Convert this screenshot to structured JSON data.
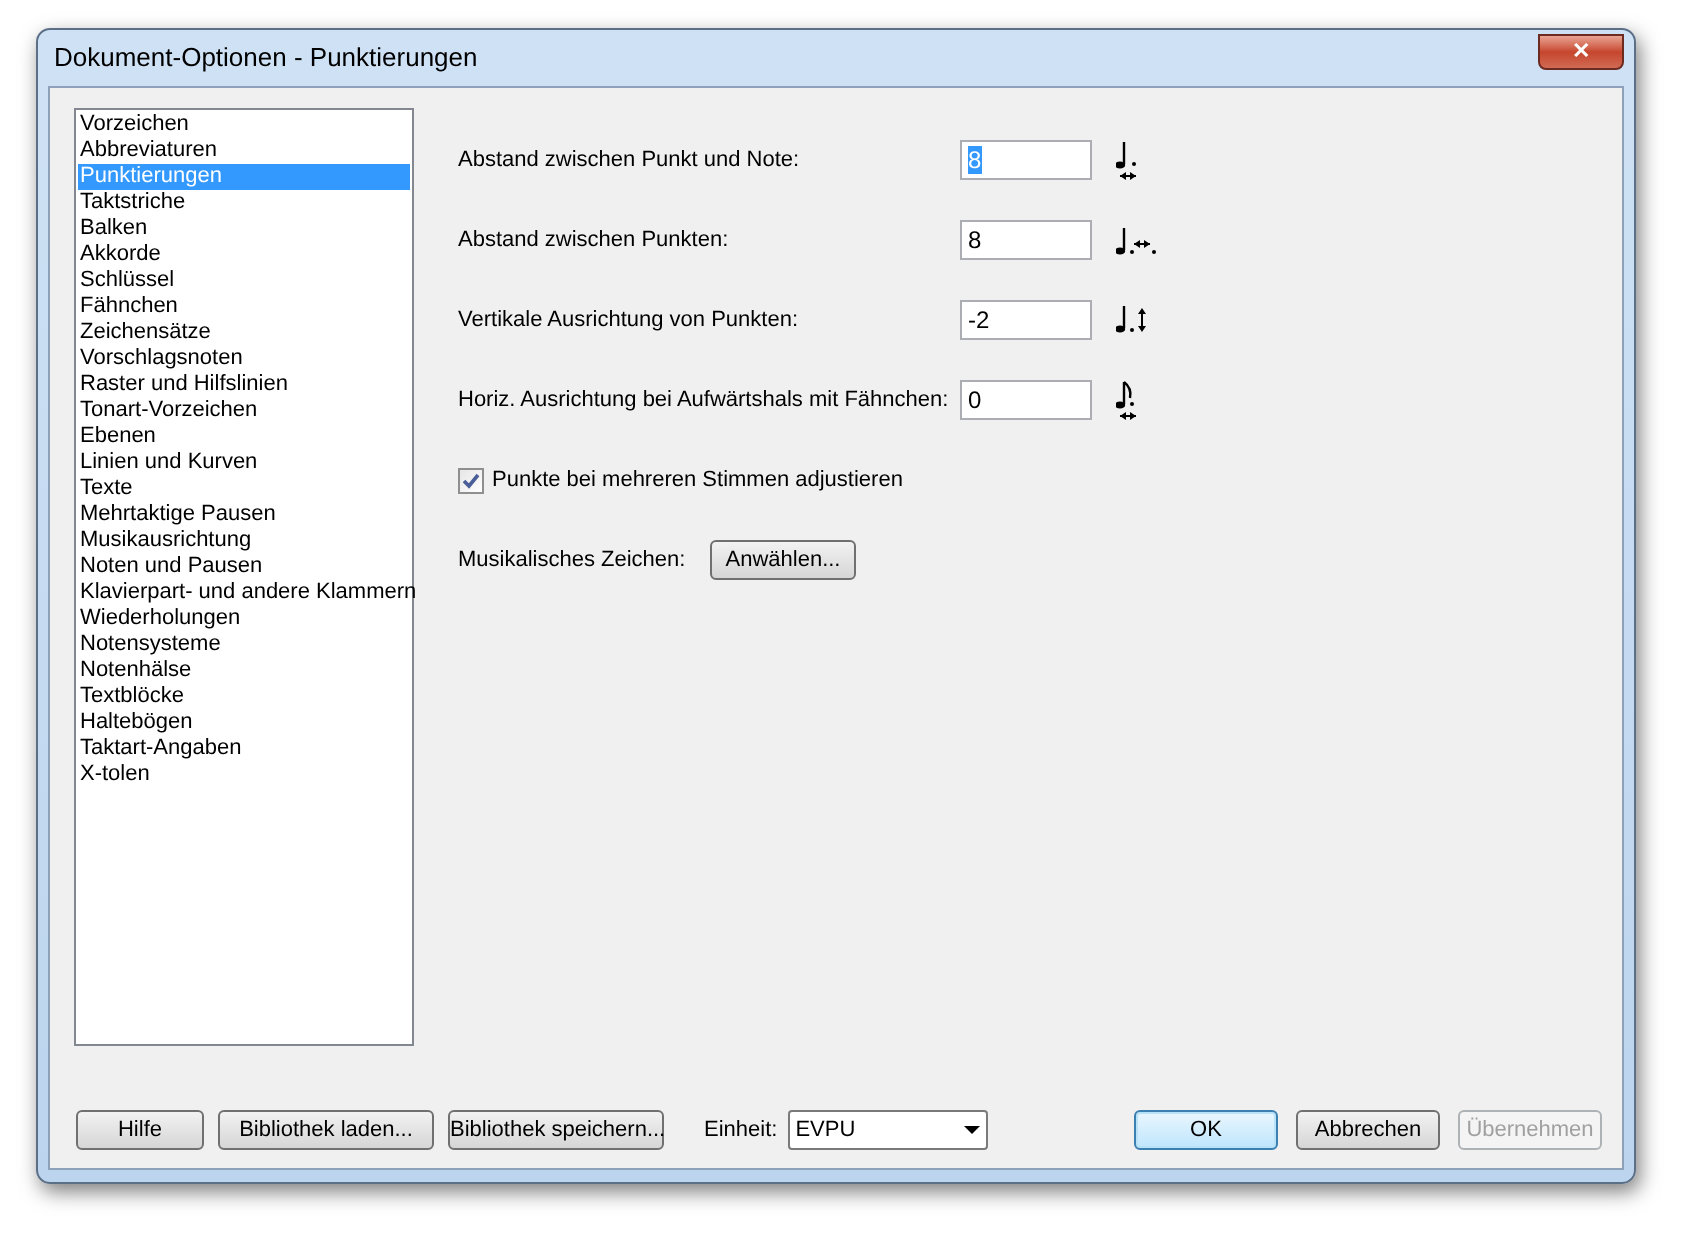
{
  "window": {
    "title": "Dokument-Optionen - Punktierungen",
    "close": "✕"
  },
  "sidebar": {
    "items": [
      {
        "label": "Vorzeichen",
        "selected": false
      },
      {
        "label": "Abbreviaturen",
        "selected": false
      },
      {
        "label": "Punktierungen",
        "selected": true
      },
      {
        "label": "Taktstriche",
        "selected": false
      },
      {
        "label": "Balken",
        "selected": false
      },
      {
        "label": "Akkorde",
        "selected": false
      },
      {
        "label": "Schlüssel",
        "selected": false
      },
      {
        "label": "Fähnchen",
        "selected": false
      },
      {
        "label": "Zeichensätze",
        "selected": false
      },
      {
        "label": "Vorschlagsnoten",
        "selected": false
      },
      {
        "label": "Raster und Hilfslinien",
        "selected": false
      },
      {
        "label": "Tonart-Vorzeichen",
        "selected": false
      },
      {
        "label": "Ebenen",
        "selected": false
      },
      {
        "label": "Linien und Kurven",
        "selected": false
      },
      {
        "label": "Texte",
        "selected": false
      },
      {
        "label": "Mehrtaktige Pausen",
        "selected": false
      },
      {
        "label": "Musikausrichtung",
        "selected": false
      },
      {
        "label": "Noten und Pausen",
        "selected": false
      },
      {
        "label": "Klavierpart- und andere Klammern",
        "selected": false
      },
      {
        "label": "Wiederholungen",
        "selected": false
      },
      {
        "label": "Notensysteme",
        "selected": false
      },
      {
        "label": "Notenhälse",
        "selected": false
      },
      {
        "label": "Textblöcke",
        "selected": false
      },
      {
        "label": "Haltebögen",
        "selected": false
      },
      {
        "label": "Taktart-Angaben",
        "selected": false
      },
      {
        "label": "X-tolen",
        "selected": false
      }
    ]
  },
  "fields": [
    {
      "label": "Abstand zwischen Punkt und Note:",
      "value": "8",
      "selected": true,
      "kind": "note-gap"
    },
    {
      "label": "Abstand zwischen Punkten:",
      "value": "8",
      "selected": false,
      "kind": "dot-gap"
    },
    {
      "label": "Vertikale Ausrichtung von Punkten:",
      "value": "-2",
      "selected": false,
      "kind": "vertical"
    },
    {
      "label": "Horiz. Ausrichtung bei Aufwärtshals mit Fähnchen:",
      "value": "0",
      "selected": false,
      "kind": "flag"
    }
  ],
  "checkbox": {
    "label": "Punkte bei mehreren Stimmen adjustieren",
    "checked": true
  },
  "symbol": {
    "label": "Musikalisches Zeichen:",
    "button": "Anwählen..."
  },
  "footer": {
    "buttons": [
      {
        "label": "Hilfe"
      },
      {
        "label": "Bibliothek laden..."
      },
      {
        "label": "Bibliothek speichern..."
      }
    ],
    "unit_label": "Einheit:",
    "unit_value": "EVPU",
    "actions": [
      {
        "label": "OK",
        "default": true,
        "disabled": false
      },
      {
        "label": "Abbrechen",
        "default": false,
        "disabled": false
      },
      {
        "label": "Übernehmen",
        "default": false,
        "disabled": true
      }
    ]
  }
}
